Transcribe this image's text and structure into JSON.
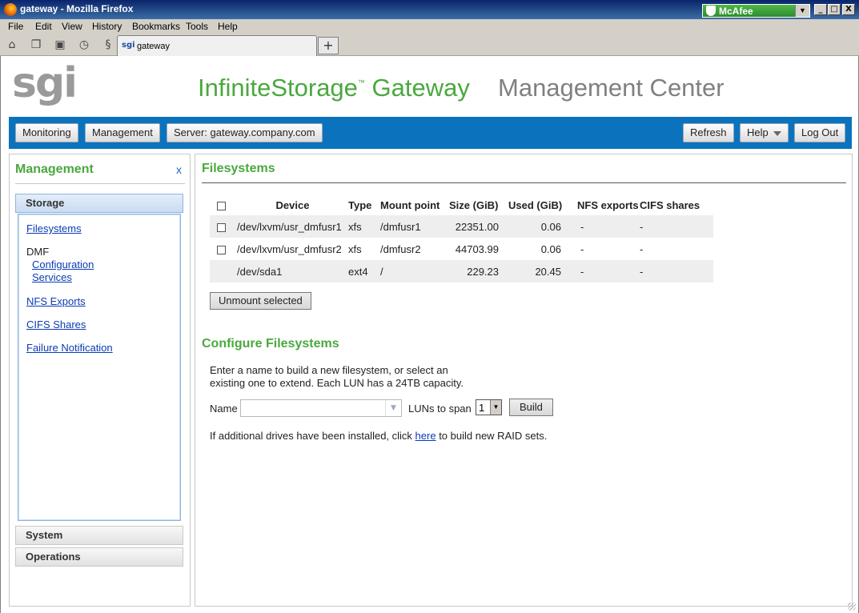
{
  "window": {
    "title": "gateway - Mozilla Firefox",
    "mcafee_label": "McAfee",
    "controls": {
      "minimize": "_",
      "maximize": "□",
      "close": "X"
    }
  },
  "menu": [
    "File",
    "Edit",
    "View",
    "History",
    "Bookmarks",
    "Tools",
    "Help"
  ],
  "browser": {
    "tab_title": "gateway",
    "tab_icon_text": "sgi",
    "new_tab_label": "+"
  },
  "header": {
    "logo": "sgi",
    "title": "InfiniteStorage",
    "trademark": "™",
    "title_suffix": "Gateway",
    "subtitle": "Management Center"
  },
  "toolbar": {
    "monitoring": "Monitoring",
    "management": "Management",
    "server": "Server: gateway.company.com",
    "refresh": "Refresh",
    "help": "Help",
    "logout": "Log Out"
  },
  "sidebar": {
    "title": "Management",
    "close": "x",
    "sections": {
      "storage": "Storage",
      "system": "System",
      "operations": "Operations"
    },
    "links": {
      "filesystems": "Filesystems",
      "dmf": "DMF",
      "configuration": "Configuration",
      "services": "Services",
      "nfs_exports": "NFS Exports",
      "cifs_shares": "CIFS Shares",
      "failure_notification": "Failure Notification"
    }
  },
  "filesystems": {
    "title": "Filesystems",
    "columns": [
      "Device",
      "Type",
      "Mount point",
      "Size (GiB)",
      "Used (GiB)",
      "NFS exports",
      "CIFS shares"
    ],
    "rows": [
      [
        "/dev/lxvm/usr_dmfusr1",
        "xfs",
        "/dmfusr1",
        "22351.00",
        "0.06",
        "-",
        "-"
      ],
      [
        "/dev/lxvm/usr_dmfusr2",
        "xfs",
        "/dmfusr2",
        "44703.99",
        "0.06",
        "-",
        "-"
      ],
      [
        "/dev/sda1",
        "ext4",
        "/",
        "229.23",
        "20.45",
        "-",
        "-"
      ]
    ],
    "unmount_button": "Unmount selected"
  },
  "configure": {
    "title": "Configure Filesystems",
    "description": "Enter a name to build a new filesystem, or select an existing one to extend. Each LUN has a 24TB capacity.",
    "name_label": "Name",
    "name_value": "",
    "luns_label": "LUNs to span",
    "luns_value": "1",
    "build_button": "Build",
    "raid_prefix": "If additional drives have been installed, click ",
    "raid_link": "here",
    "raid_suffix": " to build new RAID sets."
  }
}
